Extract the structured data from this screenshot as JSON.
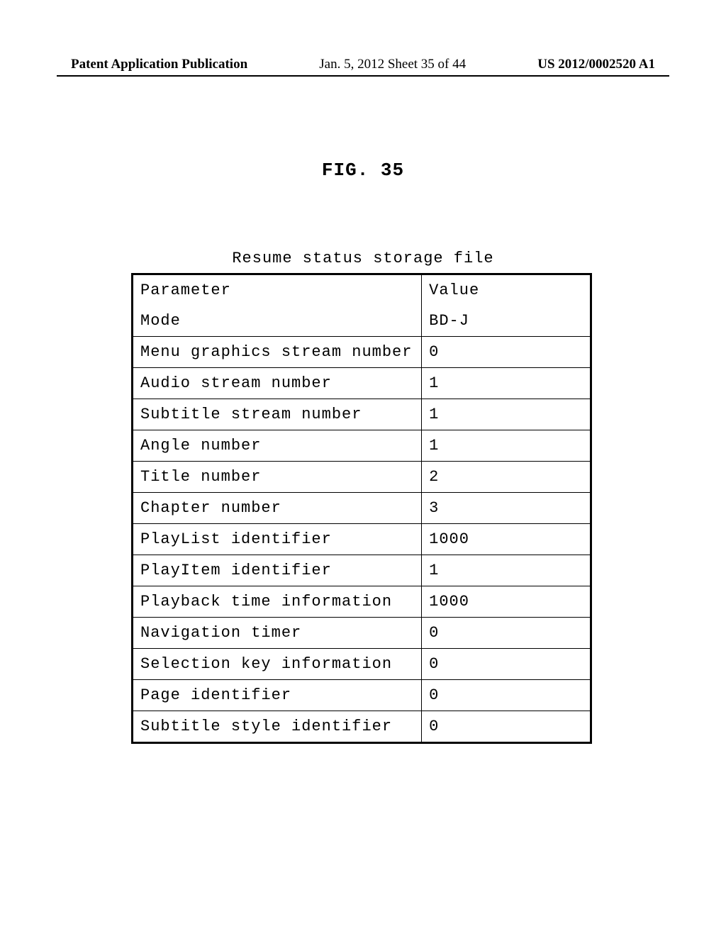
{
  "header": {
    "left": "Patent Application Publication",
    "center": "Jan. 5, 2012   Sheet 35 of 44",
    "right": "US 2012/0002520 A1"
  },
  "figure_title": "FIG. 35",
  "table_caption": "Resume status storage file",
  "chart_data": {
    "type": "table",
    "title": "Resume status storage file",
    "headers": [
      "Parameter",
      "Value"
    ],
    "rows": [
      {
        "parameter": "Mode",
        "value": "BD-J"
      },
      {
        "parameter": "Menu graphics stream number",
        "value": "0"
      },
      {
        "parameter": "Audio stream number",
        "value": "1"
      },
      {
        "parameter": "Subtitle stream number",
        "value": "1"
      },
      {
        "parameter": "Angle number",
        "value": "1"
      },
      {
        "parameter": "Title number",
        "value": "2"
      },
      {
        "parameter": "Chapter number",
        "value": "3"
      },
      {
        "parameter": "PlayList identifier",
        "value": "1000"
      },
      {
        "parameter": "PlayItem identifier",
        "value": "1"
      },
      {
        "parameter": "Playback time information",
        "value": "1000"
      },
      {
        "parameter": "Navigation timer",
        "value": "0"
      },
      {
        "parameter": "Selection key information",
        "value": "0"
      },
      {
        "parameter": "Page identifier",
        "value": "0"
      },
      {
        "parameter": "Subtitle style identifier",
        "value": "0"
      }
    ]
  }
}
